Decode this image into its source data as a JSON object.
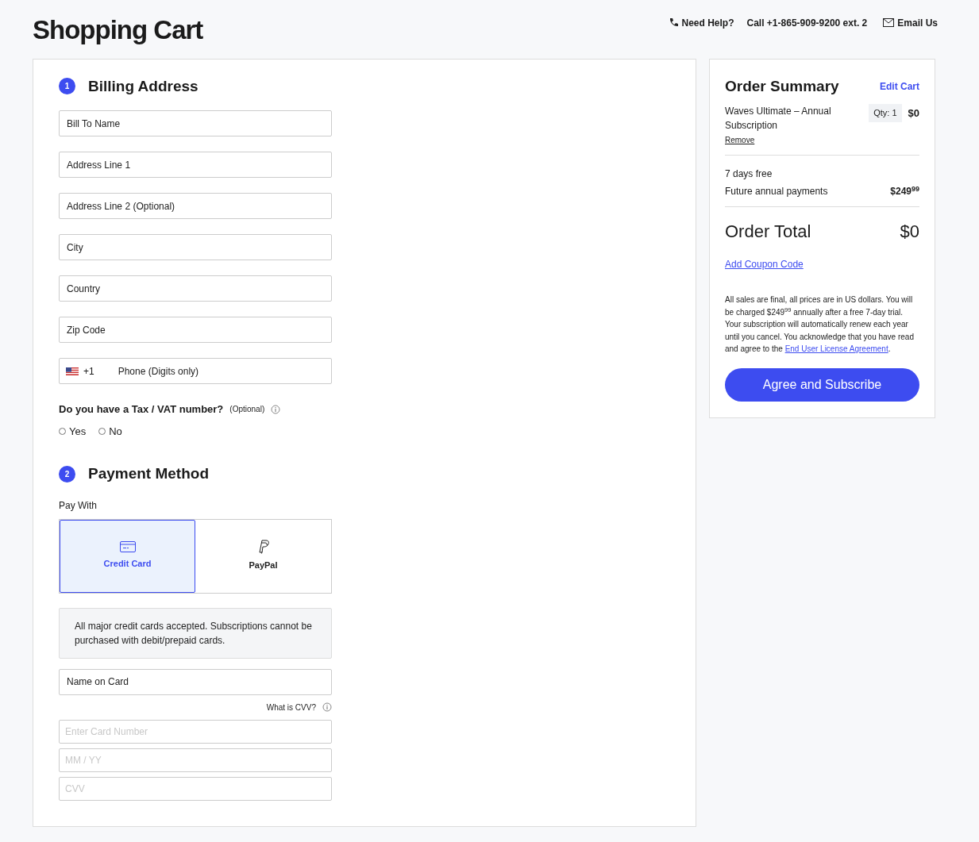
{
  "header": {
    "title": "Shopping Cart",
    "help_label": "Need Help?",
    "phone": "Call +1-865-909-9200 ext. 2",
    "email": "Email Us"
  },
  "billing": {
    "step": "1",
    "title": "Billing Address",
    "fields": [
      {
        "kind": "label",
        "placeholder": "Bill To Name"
      },
      {
        "kind": "label",
        "placeholder": "Address Line 1"
      },
      {
        "kind": "label",
        "placeholder": "Address Line 2 (Optional)"
      },
      {
        "kind": "label",
        "placeholder": "City"
      },
      {
        "kind": "label",
        "placeholder": "Country"
      },
      {
        "kind": "label",
        "placeholder": "Zip Code"
      }
    ],
    "phone": {
      "code": "+1",
      "placeholder": "Phone (Digits only)"
    },
    "tax": {
      "question": "Do you have a Tax / VAT number?",
      "note": "(Optional)",
      "options": [
        {
          "label": "Yes",
          "selected": false
        },
        {
          "label": "No",
          "selected": false
        }
      ]
    }
  },
  "payment": {
    "step": "2",
    "title": "Payment Method",
    "pay_with": "Pay With",
    "methods": [
      {
        "kind": "card",
        "label": "Credit Card",
        "selected": true
      },
      {
        "kind": "paypal",
        "label": "PayPal",
        "selected": false
      }
    ],
    "notice": "All major credit cards accepted. Subscriptions cannot be purchased with debit/prepaid cards.",
    "cvv_help": "What is CVV?",
    "fields": [
      {
        "kind": "label",
        "placeholder": "Name on Card"
      },
      {
        "kind": "hint",
        "placeholder": "Enter Card Number"
      },
      {
        "kind": "hint",
        "placeholder": "MM / YY"
      },
      {
        "kind": "hint",
        "placeholder": "CVV"
      }
    ]
  },
  "summary": {
    "title": "Order Summary",
    "edit": "Edit Cart",
    "item": {
      "name": "Waves Ultimate – Annual Subscription",
      "qty": "Qty: 1",
      "price": "$0",
      "remove": "Remove"
    },
    "trial": "7 days free",
    "future_label": "Future annual payments",
    "future_price": "$249$^{99}$",
    "total_label": "Order Total",
    "total": "$0",
    "coupon": "Add Coupon Code",
    "terms": "All sales are final, all prices are in US dollars. You will be charged $249$^{99}$ annually after a free 7-day trial. Your subscription will automatically renew each year until you cancel. You acknowledge that you have read and agree to the ",
    "terms_link": "End User License Agreement",
    "terms_end": ".",
    "button": "Agree and Subscribe"
  }
}
